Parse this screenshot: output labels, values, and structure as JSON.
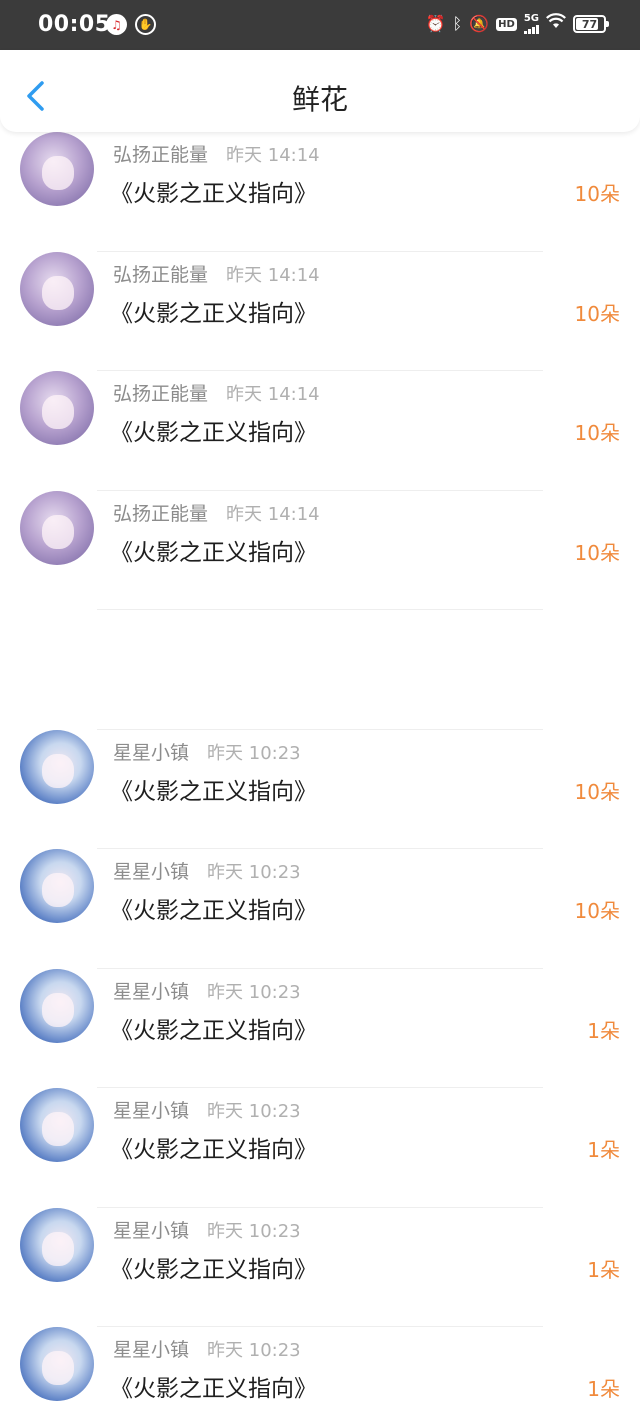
{
  "status_bar": {
    "time": "00:05",
    "battery": "77",
    "network": "5G",
    "hd": "HD",
    "icons": [
      "netease-music-icon",
      "hand-icon",
      "alarm-icon",
      "bluetooth-icon",
      "mute-icon",
      "hd-icon",
      "signal-icon",
      "wifi-icon",
      "battery-icon"
    ]
  },
  "nav": {
    "title": "鲜花",
    "back_icon": "chevron-left-icon"
  },
  "colors": {
    "accent_blue": "#2f9cf0",
    "amount_orange": "#f08a3c",
    "status_bg": "#3b3b3b"
  },
  "items": [
    {
      "user": "弘扬正能量",
      "time": "昨天 14:14",
      "title": "《火影之正义指向》",
      "amount": "10朵",
      "avatar": "purple-anime-avatar"
    },
    {
      "user": "弘扬正能量",
      "time": "昨天 14:14",
      "title": "《火影之正义指向》",
      "amount": "10朵",
      "avatar": "purple-anime-avatar"
    },
    {
      "user": "弘扬正能量",
      "time": "昨天 14:14",
      "title": "《火影之正义指向》",
      "amount": "10朵",
      "avatar": "purple-anime-avatar"
    },
    {
      "user": "弘扬正能量",
      "time": "昨天 14:14",
      "title": "《火影之正义指向》",
      "amount": "10朵",
      "avatar": "purple-anime-avatar"
    },
    {
      "user": "",
      "time": "",
      "title": "",
      "amount": "",
      "avatar": ""
    },
    {
      "user": "星星小镇",
      "time": "昨天 10:23",
      "title": "《火影之正义指向》",
      "amount": "10朵",
      "avatar": "blue-anime-avatar"
    },
    {
      "user": "星星小镇",
      "time": "昨天 10:23",
      "title": "《火影之正义指向》",
      "amount": "10朵",
      "avatar": "blue-anime-avatar"
    },
    {
      "user": "星星小镇",
      "time": "昨天 10:23",
      "title": "《火影之正义指向》",
      "amount": "1朵",
      "avatar": "blue-anime-avatar"
    },
    {
      "user": "星星小镇",
      "time": "昨天 10:23",
      "title": "《火影之正义指向》",
      "amount": "1朵",
      "avatar": "blue-anime-avatar"
    },
    {
      "user": "星星小镇",
      "time": "昨天 10:23",
      "title": "《火影之正义指向》",
      "amount": "1朵",
      "avatar": "blue-anime-avatar"
    },
    {
      "user": "星星小镇",
      "time": "昨天 10:23",
      "title": "《火影之正义指向》",
      "amount": "1朵",
      "avatar": "blue-anime-avatar"
    }
  ]
}
